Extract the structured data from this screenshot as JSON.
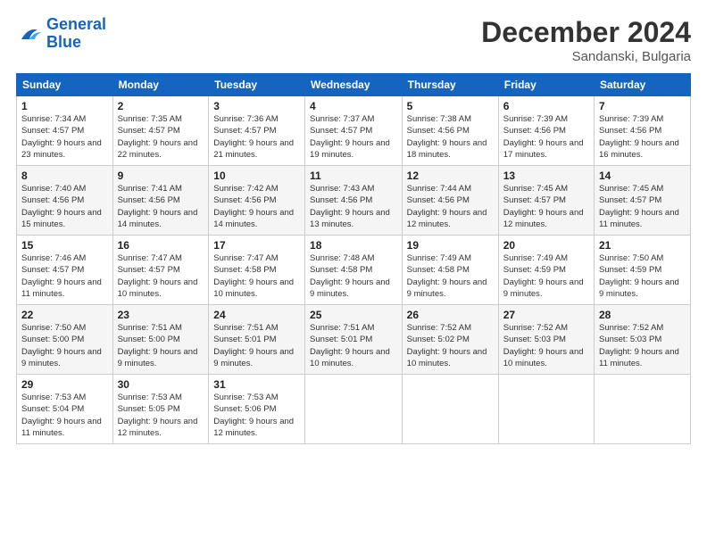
{
  "header": {
    "logo_line1": "General",
    "logo_line2": "Blue",
    "month": "December 2024",
    "location": "Sandanski, Bulgaria"
  },
  "weekdays": [
    "Sunday",
    "Monday",
    "Tuesday",
    "Wednesday",
    "Thursday",
    "Friday",
    "Saturday"
  ],
  "weeks": [
    [
      {
        "day": "1",
        "sunrise": "Sunrise: 7:34 AM",
        "sunset": "Sunset: 4:57 PM",
        "daylight": "Daylight: 9 hours and 23 minutes."
      },
      {
        "day": "2",
        "sunrise": "Sunrise: 7:35 AM",
        "sunset": "Sunset: 4:57 PM",
        "daylight": "Daylight: 9 hours and 22 minutes."
      },
      {
        "day": "3",
        "sunrise": "Sunrise: 7:36 AM",
        "sunset": "Sunset: 4:57 PM",
        "daylight": "Daylight: 9 hours and 21 minutes."
      },
      {
        "day": "4",
        "sunrise": "Sunrise: 7:37 AM",
        "sunset": "Sunset: 4:57 PM",
        "daylight": "Daylight: 9 hours and 19 minutes."
      },
      {
        "day": "5",
        "sunrise": "Sunrise: 7:38 AM",
        "sunset": "Sunset: 4:56 PM",
        "daylight": "Daylight: 9 hours and 18 minutes."
      },
      {
        "day": "6",
        "sunrise": "Sunrise: 7:39 AM",
        "sunset": "Sunset: 4:56 PM",
        "daylight": "Daylight: 9 hours and 17 minutes."
      },
      {
        "day": "7",
        "sunrise": "Sunrise: 7:39 AM",
        "sunset": "Sunset: 4:56 PM",
        "daylight": "Daylight: 9 hours and 16 minutes."
      }
    ],
    [
      {
        "day": "8",
        "sunrise": "Sunrise: 7:40 AM",
        "sunset": "Sunset: 4:56 PM",
        "daylight": "Daylight: 9 hours and 15 minutes."
      },
      {
        "day": "9",
        "sunrise": "Sunrise: 7:41 AM",
        "sunset": "Sunset: 4:56 PM",
        "daylight": "Daylight: 9 hours and 14 minutes."
      },
      {
        "day": "10",
        "sunrise": "Sunrise: 7:42 AM",
        "sunset": "Sunset: 4:56 PM",
        "daylight": "Daylight: 9 hours and 14 minutes."
      },
      {
        "day": "11",
        "sunrise": "Sunrise: 7:43 AM",
        "sunset": "Sunset: 4:56 PM",
        "daylight": "Daylight: 9 hours and 13 minutes."
      },
      {
        "day": "12",
        "sunrise": "Sunrise: 7:44 AM",
        "sunset": "Sunset: 4:56 PM",
        "daylight": "Daylight: 9 hours and 12 minutes."
      },
      {
        "day": "13",
        "sunrise": "Sunrise: 7:45 AM",
        "sunset": "Sunset: 4:57 PM",
        "daylight": "Daylight: 9 hours and 12 minutes."
      },
      {
        "day": "14",
        "sunrise": "Sunrise: 7:45 AM",
        "sunset": "Sunset: 4:57 PM",
        "daylight": "Daylight: 9 hours and 11 minutes."
      }
    ],
    [
      {
        "day": "15",
        "sunrise": "Sunrise: 7:46 AM",
        "sunset": "Sunset: 4:57 PM",
        "daylight": "Daylight: 9 hours and 11 minutes."
      },
      {
        "day": "16",
        "sunrise": "Sunrise: 7:47 AM",
        "sunset": "Sunset: 4:57 PM",
        "daylight": "Daylight: 9 hours and 10 minutes."
      },
      {
        "day": "17",
        "sunrise": "Sunrise: 7:47 AM",
        "sunset": "Sunset: 4:58 PM",
        "daylight": "Daylight: 9 hours and 10 minutes."
      },
      {
        "day": "18",
        "sunrise": "Sunrise: 7:48 AM",
        "sunset": "Sunset: 4:58 PM",
        "daylight": "Daylight: 9 hours and 9 minutes."
      },
      {
        "day": "19",
        "sunrise": "Sunrise: 7:49 AM",
        "sunset": "Sunset: 4:58 PM",
        "daylight": "Daylight: 9 hours and 9 minutes."
      },
      {
        "day": "20",
        "sunrise": "Sunrise: 7:49 AM",
        "sunset": "Sunset: 4:59 PM",
        "daylight": "Daylight: 9 hours and 9 minutes."
      },
      {
        "day": "21",
        "sunrise": "Sunrise: 7:50 AM",
        "sunset": "Sunset: 4:59 PM",
        "daylight": "Daylight: 9 hours and 9 minutes."
      }
    ],
    [
      {
        "day": "22",
        "sunrise": "Sunrise: 7:50 AM",
        "sunset": "Sunset: 5:00 PM",
        "daylight": "Daylight: 9 hours and 9 minutes."
      },
      {
        "day": "23",
        "sunrise": "Sunrise: 7:51 AM",
        "sunset": "Sunset: 5:00 PM",
        "daylight": "Daylight: 9 hours and 9 minutes."
      },
      {
        "day": "24",
        "sunrise": "Sunrise: 7:51 AM",
        "sunset": "Sunset: 5:01 PM",
        "daylight": "Daylight: 9 hours and 9 minutes."
      },
      {
        "day": "25",
        "sunrise": "Sunrise: 7:51 AM",
        "sunset": "Sunset: 5:01 PM",
        "daylight": "Daylight: 9 hours and 10 minutes."
      },
      {
        "day": "26",
        "sunrise": "Sunrise: 7:52 AM",
        "sunset": "Sunset: 5:02 PM",
        "daylight": "Daylight: 9 hours and 10 minutes."
      },
      {
        "day": "27",
        "sunrise": "Sunrise: 7:52 AM",
        "sunset": "Sunset: 5:03 PM",
        "daylight": "Daylight: 9 hours and 10 minutes."
      },
      {
        "day": "28",
        "sunrise": "Sunrise: 7:52 AM",
        "sunset": "Sunset: 5:03 PM",
        "daylight": "Daylight: 9 hours and 11 minutes."
      }
    ],
    [
      {
        "day": "29",
        "sunrise": "Sunrise: 7:53 AM",
        "sunset": "Sunset: 5:04 PM",
        "daylight": "Daylight: 9 hours and 11 minutes."
      },
      {
        "day": "30",
        "sunrise": "Sunrise: 7:53 AM",
        "sunset": "Sunset: 5:05 PM",
        "daylight": "Daylight: 9 hours and 12 minutes."
      },
      {
        "day": "31",
        "sunrise": "Sunrise: 7:53 AM",
        "sunset": "Sunset: 5:06 PM",
        "daylight": "Daylight: 9 hours and 12 minutes."
      },
      null,
      null,
      null,
      null
    ]
  ]
}
